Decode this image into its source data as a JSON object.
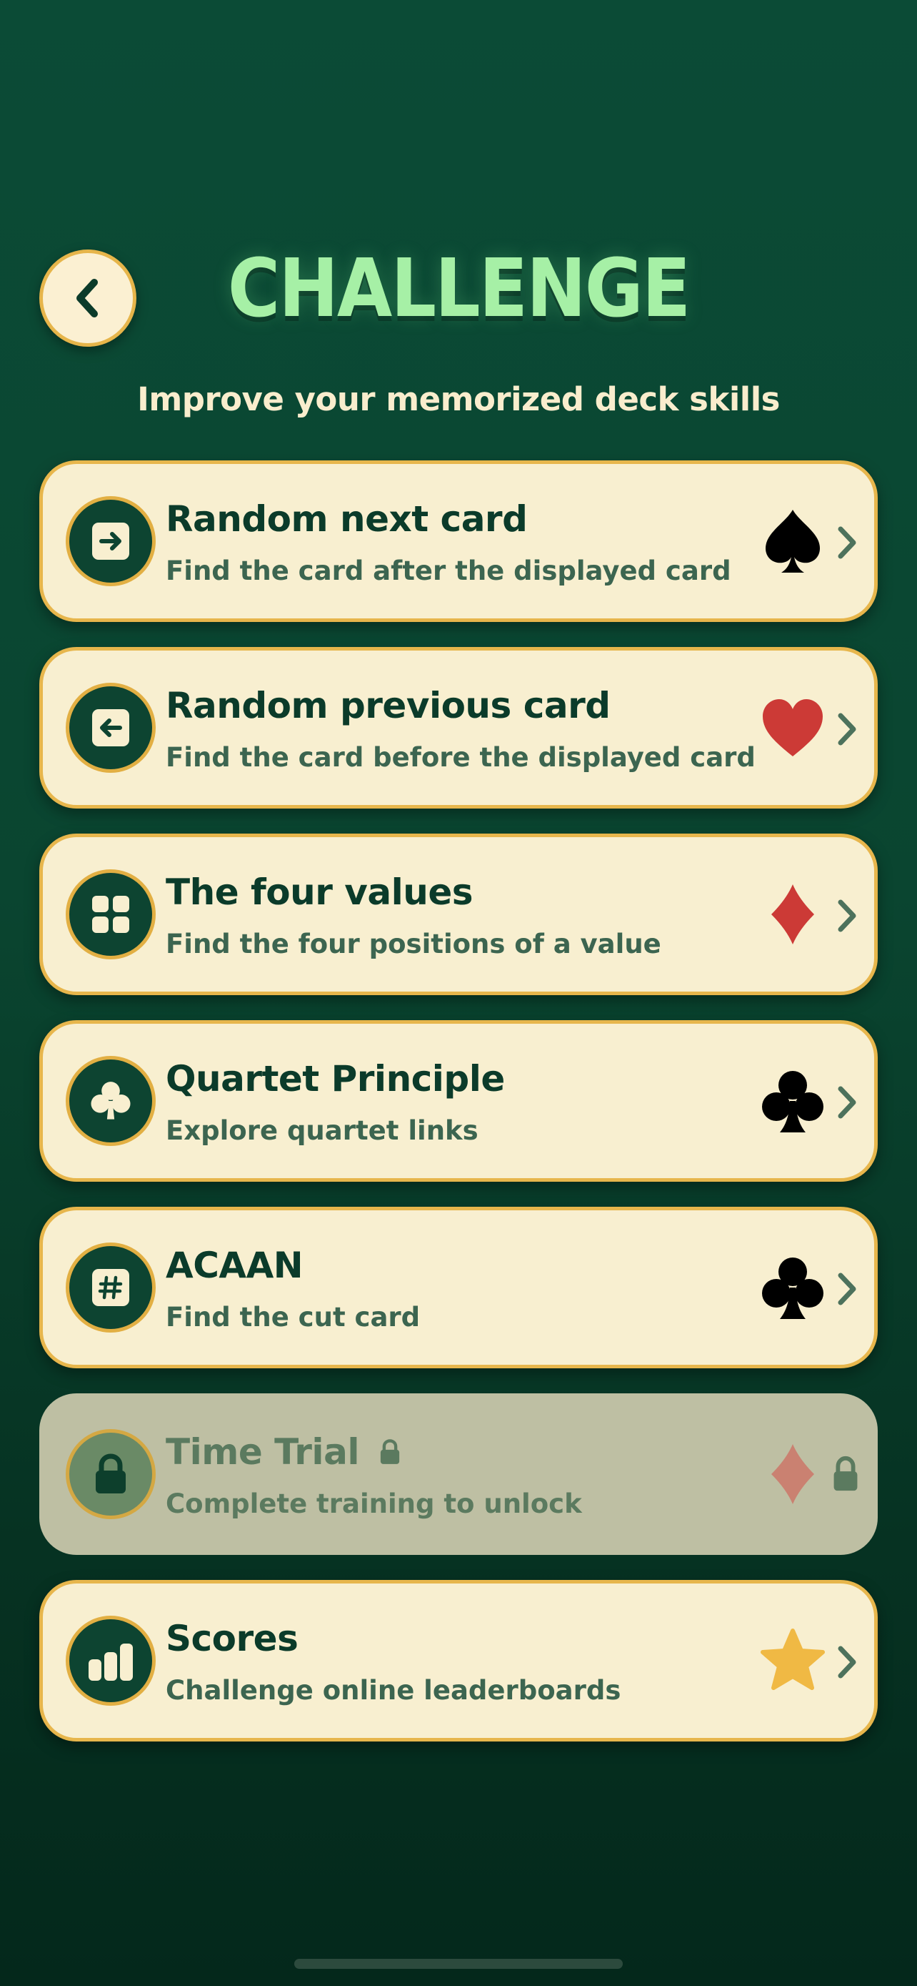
{
  "header": {
    "title": "CHALLENGE",
    "subtitle": "Improve your memorized deck skills",
    "back_icon": "chevron-left-icon"
  },
  "colors": {
    "background": "#0a4530",
    "card_background": "#f8efd0",
    "card_border": "#e7b64c",
    "title_green": "#a6f0a6",
    "dark_green": "#0b3b2a",
    "red_suit": "#cc3a36",
    "star_gold": "#f0b944",
    "locked_background": "#bebfa3"
  },
  "menu": {
    "items": [
      {
        "title": "Random next card",
        "description": "Find the card after the displayed card",
        "icon": "arrow-right-icon",
        "suit": "spade",
        "locked": false
      },
      {
        "title": "Random previous card",
        "description": "Find the card before the displayed card",
        "icon": "arrow-left-icon",
        "suit": "heart",
        "locked": false
      },
      {
        "title": "The four values",
        "description": "Find the four positions of a value",
        "icon": "grid-icon",
        "suit": "diamond",
        "locked": false
      },
      {
        "title": "Quartet Principle",
        "description": "Explore quartet links",
        "icon": "club-icon",
        "suit": "club",
        "locked": false
      },
      {
        "title": "ACAAN",
        "description": "Find the cut card",
        "icon": "hash-icon",
        "suit": "club",
        "locked": false
      },
      {
        "title": "Time Trial",
        "description": "Complete training to unlock",
        "icon": "lock-icon",
        "suit": "diamond",
        "locked": true
      },
      {
        "title": "Scores",
        "description": "Challenge online leaderboards",
        "icon": "bar-chart-icon",
        "suit": "star",
        "locked": false
      }
    ]
  }
}
